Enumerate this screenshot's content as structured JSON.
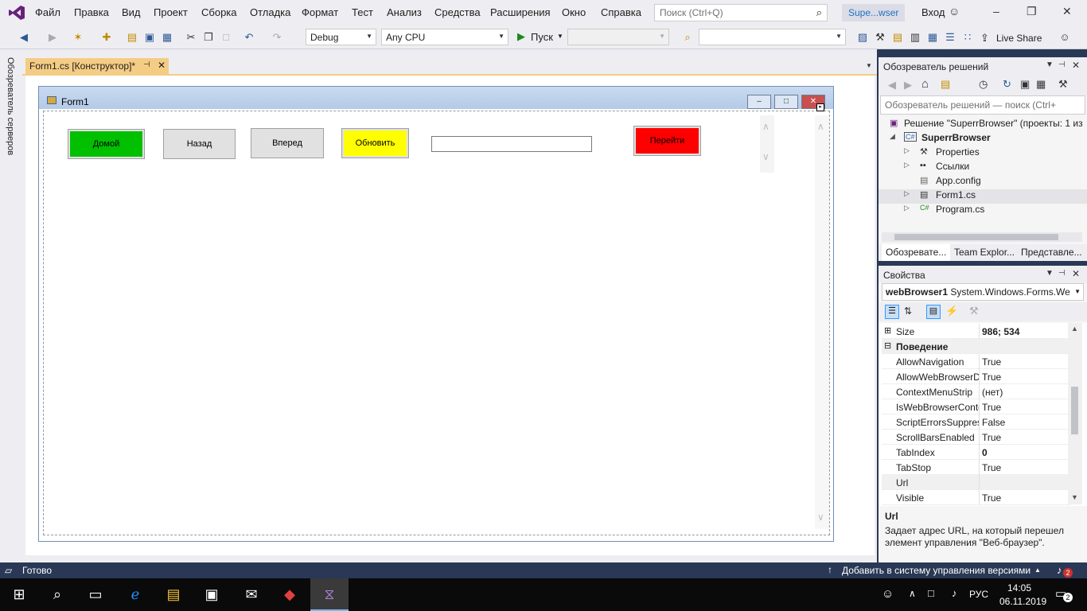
{
  "menubar": {
    "items": [
      "Файл",
      "Правка",
      "Вид",
      "Проект",
      "Сборка",
      "Отладка",
      "Формат",
      "Тест",
      "Анализ",
      "Средства",
      "Расширения",
      "Окно",
      "Справка"
    ],
    "search_placeholder": "Поиск (Ctrl+Q)",
    "solution_title": "Supe...wser",
    "login": "Вход"
  },
  "toolbar": {
    "config": "Debug",
    "platform": "Any CPU",
    "start": "Пуск",
    "live_share": "Live Share"
  },
  "left_strip": {
    "label": "Обозреватель серверов"
  },
  "doc_tab": {
    "label": "Form1.cs [Конструктор]*"
  },
  "form": {
    "title": "Form1",
    "buttons": {
      "home": "Домой",
      "back": "Назад",
      "forward": "Вперед",
      "refresh": "Обновить",
      "go": "Перейти"
    },
    "address_value": ""
  },
  "solution_explorer": {
    "title": "Обозреватель решений",
    "search_placeholder": "Обозреватель решений — поиск (Ctrl+",
    "solution_label": "Решение \"SuperrBrowser\" (проекты: 1 из",
    "project": "SuperrBrowser",
    "items": [
      "Properties",
      "Ссылки",
      "App.config",
      "Form1.cs",
      "Program.cs"
    ],
    "tabs": [
      "Обозревате...",
      "Team Explor...",
      "Представле..."
    ]
  },
  "properties": {
    "title": "Свойства",
    "object_name": "webBrowser1",
    "object_type": "System.Windows.Forms.We",
    "rows": [
      {
        "name": "Size",
        "value": "986; 534",
        "bold": true
      },
      {
        "name": "Поведение",
        "value": "",
        "category": true
      },
      {
        "name": "AllowNavigation",
        "value": "True"
      },
      {
        "name": "AllowWebBrowserD",
        "value": "True"
      },
      {
        "name": "ContextMenuStrip",
        "value": "(нет)"
      },
      {
        "name": "IsWebBrowserConte",
        "value": "True"
      },
      {
        "name": "ScriptErrorsSuppres",
        "value": "False"
      },
      {
        "name": "ScrollBarsEnabled",
        "value": "True"
      },
      {
        "name": "TabIndex",
        "value": "0",
        "bold": true
      },
      {
        "name": "TabStop",
        "value": "True"
      },
      {
        "name": "Url",
        "value": ""
      },
      {
        "name": "Visible",
        "value": "True"
      }
    ],
    "desc_title": "Url",
    "desc_text": "Задает адрес URL, на который перешел элемент управления \"Веб-браузер\"."
  },
  "statusbar": {
    "status": "Готово",
    "vcs": "Добавить в систему управления версиями",
    "notif_count": "2"
  },
  "taskbar": {
    "lang": "РУС",
    "time": "14:05",
    "date": "06.11.2019",
    "notif": "2"
  },
  "colors": {
    "accent": "#68217a",
    "home_btn": "#00c000",
    "refresh_btn": "#ffff00",
    "go_btn": "#ff0000",
    "status_bg": "#293955"
  }
}
